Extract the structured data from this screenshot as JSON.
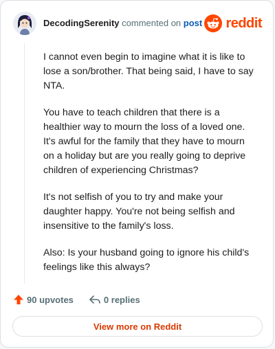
{
  "header": {
    "username": "DecodingSerenity",
    "action_text": "commented on",
    "link_text": "post",
    "brand": "reddit"
  },
  "comment": {
    "paragraphs": [
      "I cannot even begin to imagine what it is like to lose a son/brother. That being said, I have to say NTA.",
      "You have to teach children that there is a healthier way to mourn the loss of a loved one. It's awful for the family that they have to mourn on a holiday but are you really going to deprive children of experiencing Christmas?",
      "It's not selfish of you to try and make your daughter happy. You're not being selfish and insensitive to the family's loss.",
      "Also: Is your husband going to ignore his child's feelings like this always?"
    ]
  },
  "actions": {
    "upvotes": "90 upvotes",
    "replies": "0 replies"
  },
  "footer": {
    "view_more": "View more on Reddit"
  },
  "colors": {
    "brand": "#ff4500",
    "link": "#0a5bb5",
    "upvote": "#ff4500"
  },
  "icons": [
    "avatar",
    "reddit-logo-icon",
    "upvote-arrow-icon",
    "reply-icon"
  ]
}
